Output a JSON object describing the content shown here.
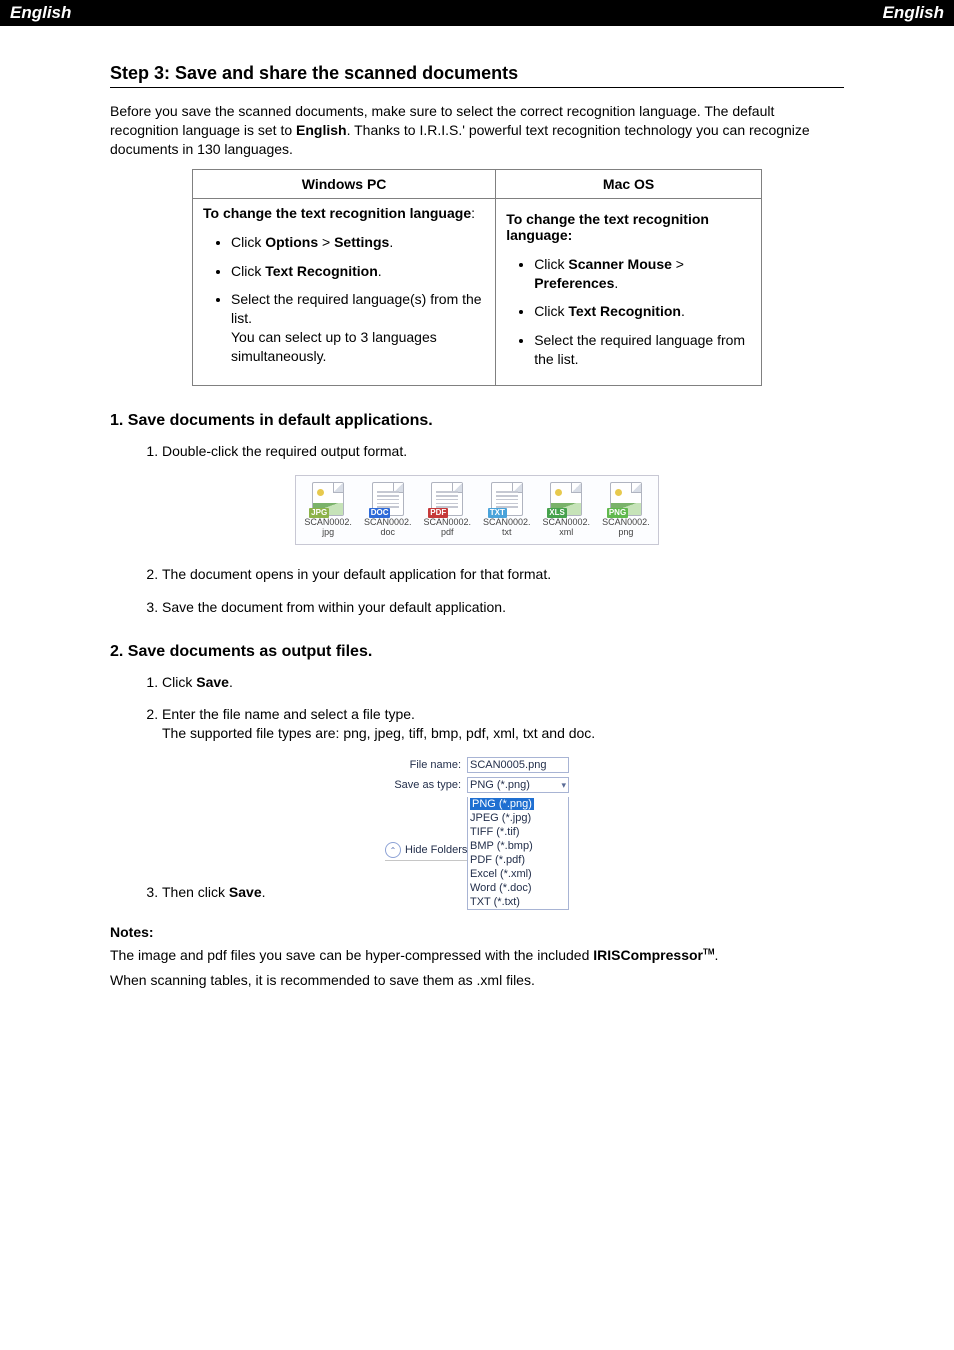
{
  "topbar": {
    "left": "English",
    "right": "English"
  },
  "step3_heading": "Step 3: Save and share the scanned documents",
  "intro": {
    "p1a": "Before you save the scanned documents, make sure to select the correct recognition language. The default recognition language is set to ",
    "p1b": "English",
    "p1c": ". Thanks to I.R.I.S.' powerful text recognition technology you can recognize documents in 130 languages."
  },
  "langtable": {
    "head": {
      "win": "Windows PC",
      "mac": "Mac OS"
    },
    "win": {
      "title": "To change the text recognition language",
      "colon": ":",
      "b1a": "Click ",
      "b1b": "Options",
      "b1c": " > ",
      "b1d": "Settings",
      "b1e": ".",
      "b2a": "Click ",
      "b2b": "Text Recognition",
      "b2c": ".",
      "b3a": "Select the required language(s) from the list.",
      "b3b": "You can select up to 3 languages simultaneously."
    },
    "mac": {
      "title": "To change the text recognition language:",
      "b1a": "Click ",
      "b1b": "Scanner Mouse",
      "b1c": " > ",
      "b1d": "Preferences",
      "b1e": ".",
      "b2a": "Click ",
      "b2b": "Text Recognition",
      "b2c": ".",
      "b3": "Select the required language from the list."
    }
  },
  "section1_heading": "1. Save documents in default applications.",
  "sec1": {
    "i1": "Double-click the required output format.",
    "i2": "The document opens in your default application for that format.",
    "i3": "Save the document from within your default application."
  },
  "formats": [
    {
      "badge": "JPG",
      "badge_color": "#8db34a",
      "img": "img",
      "name": "SCAN0002.",
      "ext": "jpg"
    },
    {
      "badge": "DOC",
      "badge_color": "#2f6bd8",
      "img": "lines",
      "name": "SCAN0002.",
      "ext": "doc"
    },
    {
      "badge": "PDF",
      "badge_color": "#c63a3a",
      "img": "lines",
      "name": "SCAN0002.",
      "ext": "pdf"
    },
    {
      "badge": "TXT",
      "badge_color": "#4aa3da",
      "img": "lines",
      "name": "SCAN0002.",
      "ext": "txt"
    },
    {
      "badge": "XLS",
      "badge_color": "#46a24c",
      "img": "img",
      "name": "SCAN0002.",
      "ext": "xml"
    },
    {
      "badge": "PNG",
      "badge_color": "#60b94d",
      "img": "img",
      "name": "SCAN0002.",
      "ext": "png"
    }
  ],
  "section2_heading": "2. Save documents as output files.",
  "sec2": {
    "i1a": "Click ",
    "i1b": "Save",
    "i1c": ".",
    "i2a": "Enter the file name and select a file type.",
    "i2b": "The supported file types are: png, jpeg, tiff, bmp, pdf, xml, txt and doc.",
    "i3a": "Then click ",
    "i3b": "Save",
    "i3c": "."
  },
  "saveas": {
    "filename_label": "File name:",
    "filename_value": "SCAN0005.png",
    "saveas_label": "Save as type:",
    "saveas_value": "PNG (*.png)",
    "hide": "Hide Folders",
    "opts": [
      "PNG (*.png)",
      "JPEG (*.jpg)",
      "TIFF (*.tif)",
      "BMP (*.bmp)",
      "PDF (*.pdf)",
      "Excel (*.xml)",
      "Word (*.doc)",
      "TXT (*.txt)"
    ]
  },
  "notes": {
    "heading": "Notes:",
    "p1a": "The image and pdf files you save can be hyper-compressed with the included ",
    "p1b": "IRISCompressor",
    "p1tm": "TM",
    "p1c": ".",
    "p2": "When scanning tables, it is recommended to save them as .xml files."
  }
}
